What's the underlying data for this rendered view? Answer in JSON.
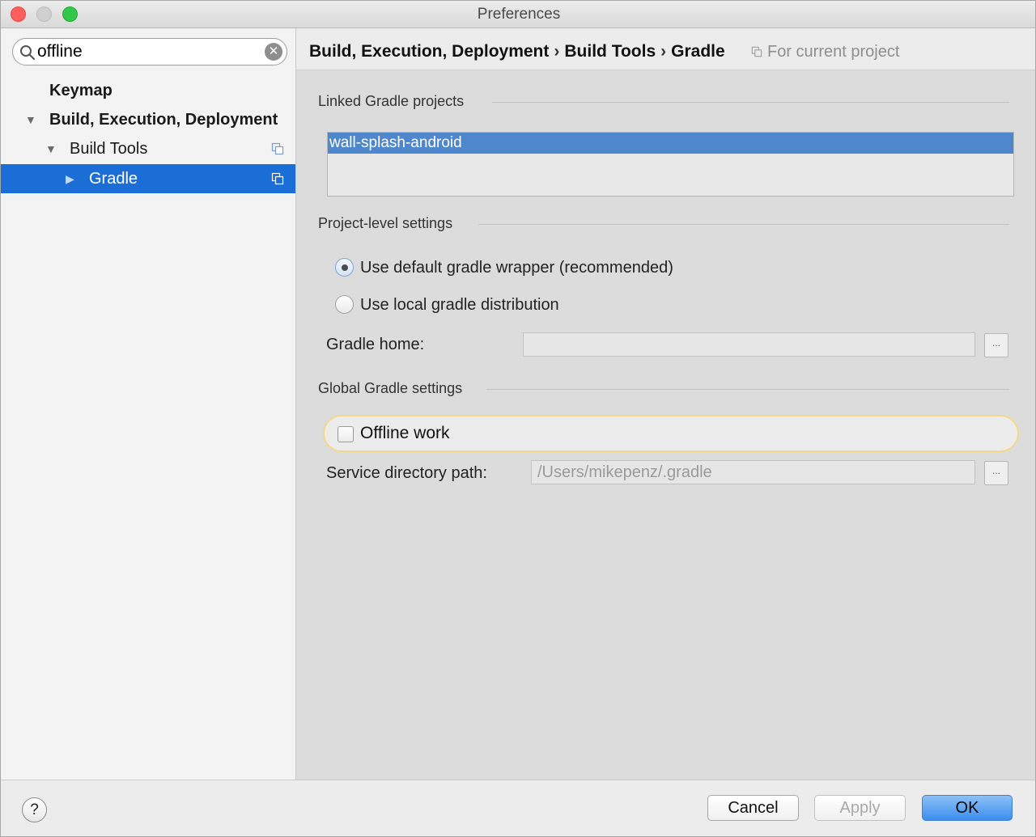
{
  "window": {
    "title": "Preferences"
  },
  "search": {
    "value": "offline"
  },
  "tree": {
    "items": [
      {
        "label": "Keymap"
      },
      {
        "label": "Build, Execution, Deployment"
      },
      {
        "label": "Build Tools"
      },
      {
        "label": "Gradle"
      }
    ]
  },
  "header": {
    "breadcrumb": [
      "Build, Execution, Deployment",
      "Build Tools",
      "Gradle"
    ],
    "separator": "›",
    "scope": "For current project"
  },
  "linked": {
    "title": "Linked Gradle projects",
    "items": [
      "wall-splash-android"
    ]
  },
  "project_settings": {
    "title": "Project-level settings",
    "option_default": "Use default gradle wrapper (recommended)",
    "option_local": "Use local gradle distribution",
    "selected": "default",
    "gradle_home_label": "Gradle home:",
    "gradle_home_value": "",
    "browse": "..."
  },
  "global_settings": {
    "title": "Global Gradle settings",
    "offline_label": "Offline work",
    "offline_checked": false,
    "service_dir_label": "Service directory path:",
    "service_dir_value": "/Users/mikepenz/.gradle",
    "browse": "..."
  },
  "footer": {
    "help": "?",
    "cancel": "Cancel",
    "apply": "Apply",
    "ok": "OK"
  },
  "colors": {
    "selection": "#1b6ed6",
    "list_selection": "#4e87cc",
    "highlight_border": "#f3d98a",
    "primary_button": "#3c8ef0",
    "close": "#fc605c",
    "zoom": "#34c84a"
  }
}
